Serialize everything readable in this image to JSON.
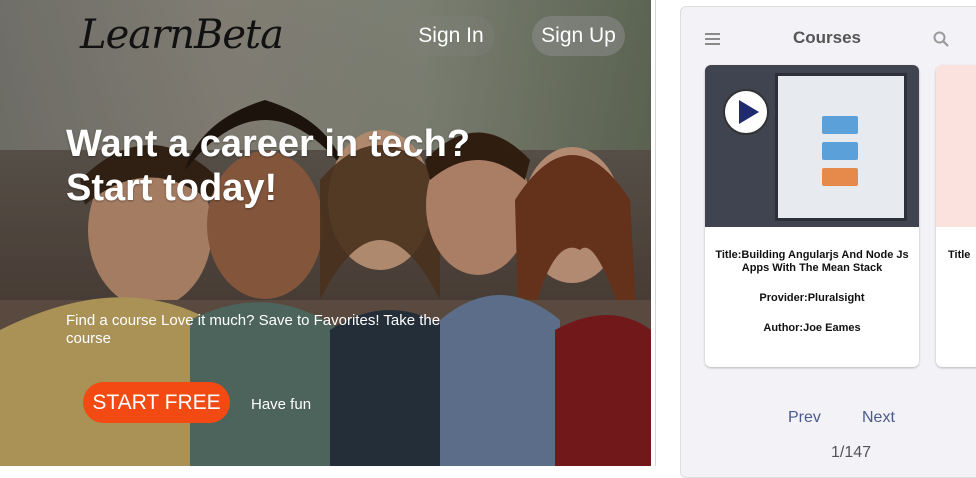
{
  "landing": {
    "logo": "LearnBeta",
    "nav": {
      "sign_in": "Sign In",
      "sign_up": "Sign Up"
    },
    "headline_line1": "Want a career in tech?",
    "headline_line2": "Start today!",
    "tagline": "Find a course Love it much? Save to Favorites! Take the course",
    "start_button": "START FREE",
    "secondary_text": "Have fun"
  },
  "app": {
    "title": "Courses",
    "cards": [
      {
        "title": "Title:Building Angularjs And Node Js Apps With The Mean Stack",
        "provider": "Provider:Pluralsight",
        "author": "Author:Joe Eames"
      },
      {
        "title": "Title"
      }
    ],
    "pager": {
      "prev": "Prev",
      "next": "Next",
      "page": "1/147"
    }
  },
  "colors": {
    "accent": "#f24a12",
    "pager": "#4a5a8c",
    "app_bg": "#f3f2f7"
  },
  "icons": [
    "menu-icon",
    "search-icon",
    "play-icon"
  ]
}
